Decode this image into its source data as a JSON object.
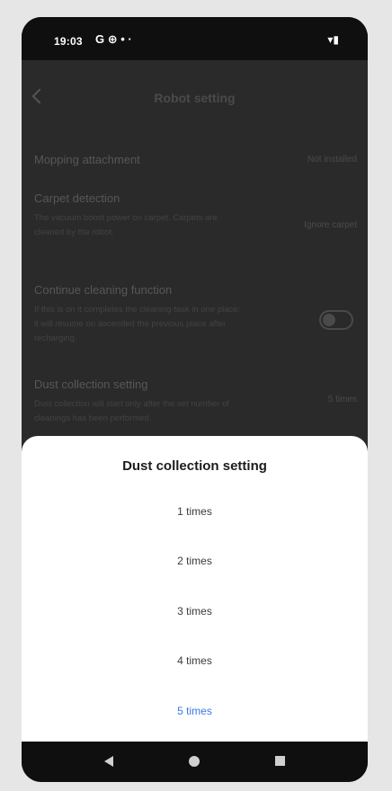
{
  "status_bar": {
    "time": "19:03",
    "icons": "G ⊕ • ·",
    "right_icons": "▾▮"
  },
  "header": {
    "title": "Robot setting"
  },
  "settings": [
    {
      "title": "Mopping attachment",
      "description": "",
      "value": "Not installed"
    },
    {
      "title": "Carpet detection",
      "description": "The vacuum boost power on carpet. Carpets are cleaned by the robot.",
      "value": "Ignore carpet"
    },
    {
      "title": "Continue cleaning function",
      "description": "If this is on it completes the cleaning task in one place; it will resume on ascended the previous place after recharging.",
      "value": "",
      "toggle": false
    },
    {
      "title": "Dust collection setting",
      "description": "Dust collection will start only after the set number of cleanings has been performed.",
      "value": "5 times"
    }
  ],
  "sheet": {
    "title": "Dust collection setting",
    "options": [
      "1 times",
      "2 times",
      "3 times",
      "4 times",
      "5 times"
    ],
    "selected_index": 4,
    "accent_color": "#3b78e7"
  },
  "nav": {
    "back": "back-triangle-icon",
    "home": "home-circle-icon",
    "recents": "recents-square-icon"
  }
}
